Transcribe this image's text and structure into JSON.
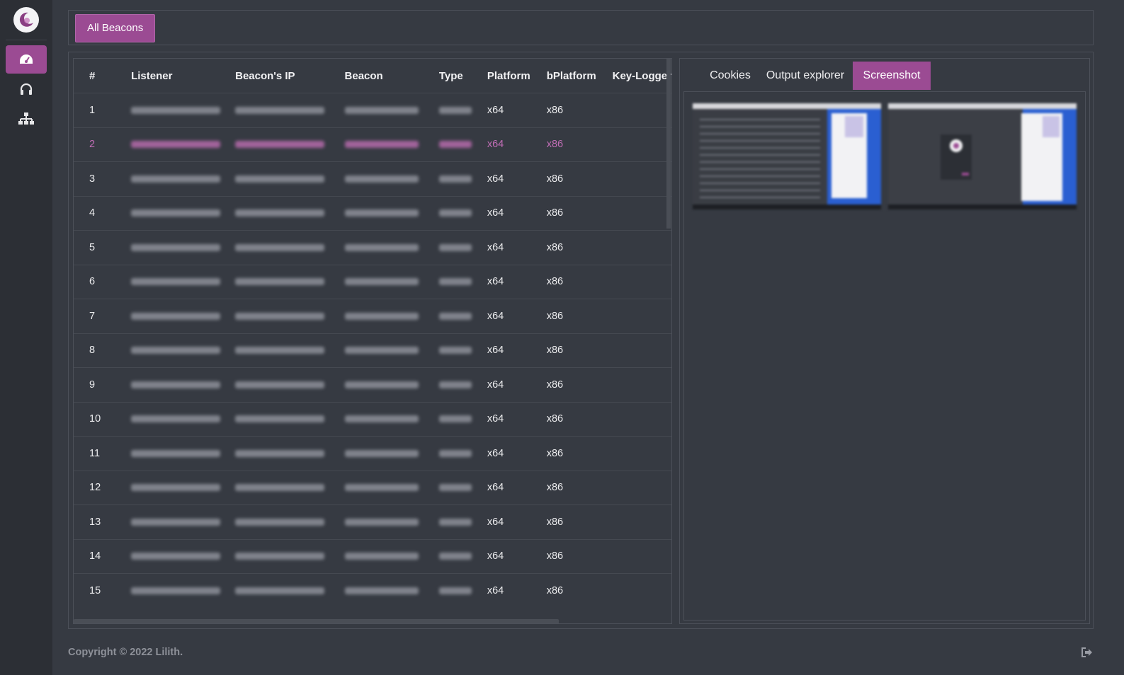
{
  "app": {
    "name": "Lilith"
  },
  "sidebar": {
    "items": [
      {
        "icon": "dashboard-icon",
        "active": true
      },
      {
        "icon": "headphones-icon",
        "active": false
      },
      {
        "icon": "sitemap-icon",
        "active": false
      }
    ]
  },
  "toolbar": {
    "all_beacons_label": "All Beacons"
  },
  "table": {
    "columns": [
      "#",
      "Listener",
      "Beacon's IP",
      "Beacon",
      "Type",
      "Platform",
      "bPlatform",
      "Key-Logger"
    ],
    "selected_row": 2,
    "rows": [
      {
        "num": "1",
        "platform": "x64",
        "bplatform": "x86"
      },
      {
        "num": "2",
        "platform": "x64",
        "bplatform": "x86"
      },
      {
        "num": "3",
        "platform": "x64",
        "bplatform": "x86"
      },
      {
        "num": "4",
        "platform": "x64",
        "bplatform": "x86"
      },
      {
        "num": "5",
        "platform": "x64",
        "bplatform": "x86"
      },
      {
        "num": "6",
        "platform": "x64",
        "bplatform": "x86"
      },
      {
        "num": "7",
        "platform": "x64",
        "bplatform": "x86"
      },
      {
        "num": "8",
        "platform": "x64",
        "bplatform": "x86"
      },
      {
        "num": "9",
        "platform": "x64",
        "bplatform": "x86"
      },
      {
        "num": "10",
        "platform": "x64",
        "bplatform": "x86"
      },
      {
        "num": "11",
        "platform": "x64",
        "bplatform": "x86"
      },
      {
        "num": "12",
        "platform": "x64",
        "bplatform": "x86"
      },
      {
        "num": "13",
        "platform": "x64",
        "bplatform": "x86"
      },
      {
        "num": "14",
        "platform": "x64",
        "bplatform": "x86"
      },
      {
        "num": "15",
        "platform": "x64",
        "bplatform": "x86"
      }
    ]
  },
  "tabs": [
    {
      "label": "Cookies",
      "active": false
    },
    {
      "label": "Output explorer",
      "active": false
    },
    {
      "label": "Screenshot",
      "active": true
    }
  ],
  "footer": {
    "copyright": "Copyright © 2022 Lilith."
  },
  "colors": {
    "accent": "#9b4b93",
    "background": "#363a42",
    "sidebar": "#2c2f35",
    "selected_text": "#c06db5"
  }
}
